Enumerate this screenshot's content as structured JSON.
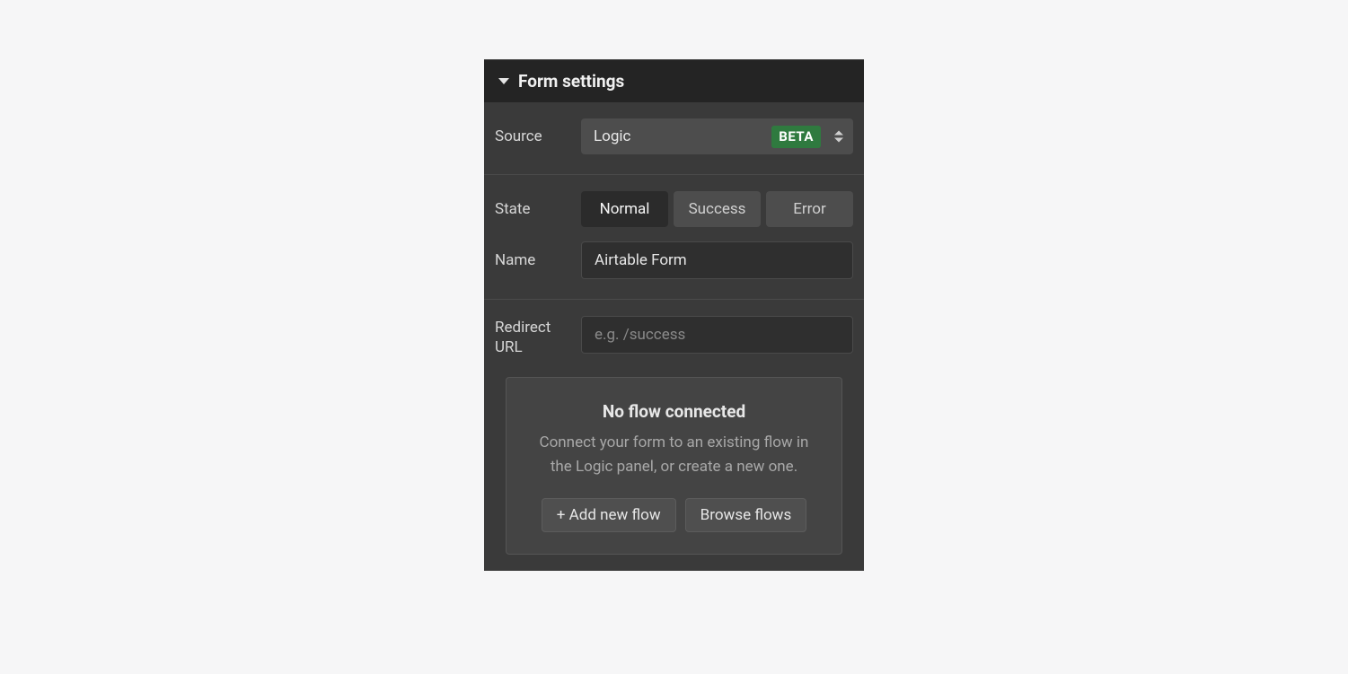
{
  "panel": {
    "title": "Form settings"
  },
  "source": {
    "label": "Source",
    "selected": "Logic",
    "badge": "BETA"
  },
  "state": {
    "label": "State",
    "options": [
      "Normal",
      "Success",
      "Error"
    ],
    "selected": "Normal"
  },
  "name": {
    "label": "Name",
    "value": "Airtable Form"
  },
  "redirect": {
    "label": "Redirect URL",
    "placeholder": "e.g. /success",
    "value": ""
  },
  "flow": {
    "heading": "No flow connected",
    "description": "Connect your form to an existing flow in the Logic panel, or create a new one.",
    "add_label": "+ Add new flow",
    "browse_label": "Browse flows"
  }
}
